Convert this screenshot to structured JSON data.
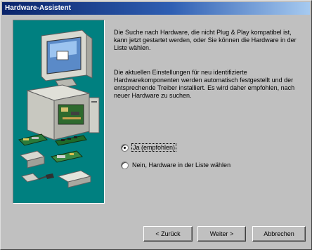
{
  "window": {
    "title": "Hardware-Assistent"
  },
  "content": {
    "paragraph1": "Die Suche nach Hardware, die nicht Plug & Play kompatibel ist, kann jetzt gestartet werden, oder Sie können die Hardware in der Liste wählen.",
    "paragraph2": "Die aktuellen Einstellungen für neu identifizierte Hardwarekomponenten werden automatisch festgestellt und der entsprechende Treiber installiert. Es wird daher empfohlen, nach neuer Hardware zu suchen."
  },
  "options": [
    {
      "label": "Ja (empfohlen)",
      "selected": true
    },
    {
      "label": "Nein, Hardware in der Liste wählen",
      "selected": false
    }
  ],
  "buttons": {
    "back": "< Zurück",
    "next": "Weiter >",
    "cancel": "Abbrechen"
  },
  "colors": {
    "titlebar_start": "#0a246a",
    "titlebar_end": "#a6caf0",
    "illustration_bg": "#008080",
    "face": "#c0c0c0"
  }
}
